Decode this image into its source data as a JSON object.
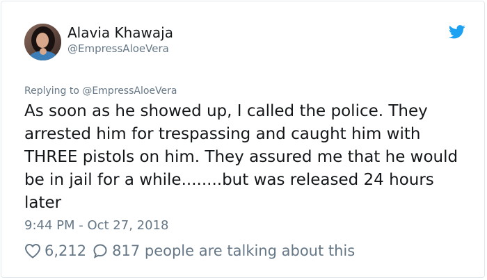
{
  "author": {
    "name": "Alavia Khawaja",
    "handle": "@EmpressAloeVera"
  },
  "reply": {
    "text": "Replying to @EmpressAloeVera"
  },
  "tweet": {
    "text": "As soon as he showed up, I called the police. They arrested him for trespassing and caught him with THREE pistols on him. They assured me that he would be in jail for a while........but was released 24 hours later",
    "timestamp": "9:44 PM - Oct 27, 2018"
  },
  "stats": {
    "likes": "6,212",
    "talking": "817 people are talking about this"
  },
  "colors": {
    "twitter_blue": "#1da1f2",
    "secondary_text": "#657786"
  },
  "icons": {
    "brand": "twitter-bird-icon",
    "like": "heart-icon",
    "reply": "speech-bubble-icon"
  }
}
